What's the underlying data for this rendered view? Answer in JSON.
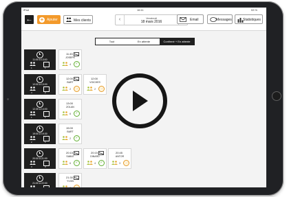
{
  "statusbar": {
    "left": "iPad",
    "time": "16:11",
    "battery": "53 %"
  },
  "toolbar": {
    "add_label": "Ajouter",
    "clients_label": "Mes clients",
    "day": "Vendredi",
    "date": "18 mars 2016",
    "email_label": "Email",
    "messages_label": "Messages",
    "stats_label": "Statistiques"
  },
  "filters": [
    {
      "label": "Tout",
      "active": false
    },
    {
      "label": "En attente",
      "active": false
    },
    {
      "label": "Confirmé + En attente",
      "active": true
    }
  ],
  "slots": [
    {
      "time": "11:00 à 13:00",
      "people": "1",
      "tables": "1"
    },
    {
      "time": "12:00 à 13:00",
      "people": "4",
      "tables": "2"
    },
    {
      "time": "12:30 à 14:00",
      "people": "1",
      "tables": "1"
    },
    {
      "time": "19:00 à 19:30",
      "people": "2",
      "tables": "1"
    },
    {
      "time": "20:00 à 21:00",
      "people": "3",
      "tables": "3"
    },
    {
      "time": "21:00 à 22:00",
      "people": "1",
      "tables": "1"
    }
  ],
  "reservations": [
    {
      "time": "11:45",
      "name": "JOSEPE",
      "count": "4",
      "status": "confirmed"
    },
    {
      "time": "12:00",
      "name": "BART",
      "count": "2",
      "status": "pending"
    },
    {
      "time": "12:00",
      "name": "VOICHES",
      "count": "2",
      "status": "pending"
    },
    {
      "time": "13:00",
      "name": "ZOLAN",
      "count": "6",
      "status": "confirmed"
    },
    {
      "time": "15:00",
      "name": "BART",
      "count": "2",
      "status": "confirmed"
    },
    {
      "time": "20:15",
      "name": "SABAT",
      "count": "6",
      "status": "confirmed"
    },
    {
      "time": "20:15",
      "name": "DINARD",
      "count": "4",
      "status": "confirmed"
    },
    {
      "time": "20:45",
      "name": "ANTOR",
      "count": "3",
      "status": "pending"
    },
    {
      "time": "21:30",
      "name": "YVON",
      "count": "2",
      "status": "pending"
    }
  ],
  "colors": {
    "accent": "#f39a2b",
    "confirmed": "#5fae2e",
    "pending": "#e69a27",
    "dark": "#202020"
  },
  "icons": {
    "play": "play-icon",
    "back": "back-arrow-icon",
    "add": "plus-icon",
    "clients": "people-icon",
    "email": "envelope-icon",
    "messages": "chat-icon",
    "stats": "bar-chart-icon"
  }
}
